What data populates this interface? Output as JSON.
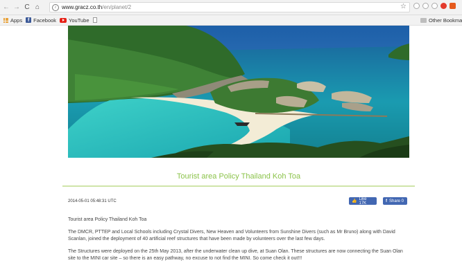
{
  "browser": {
    "url_host": "www.gracz.co.th",
    "url_path": "/en/planet/2",
    "nav": {
      "back": "←",
      "forward": "→",
      "reload": "C",
      "home": "⌂"
    },
    "star": "☆",
    "bookmarks": [
      {
        "label": "Apps",
        "icon": "apps-icon"
      },
      {
        "label": "Facebook",
        "icon": "facebook-icon"
      },
      {
        "label": "YouTube",
        "icon": "youtube-icon"
      },
      {
        "label": "",
        "icon": "document-icon"
      }
    ],
    "other_bookmarks": "Other Bookmarks"
  },
  "article": {
    "title": "Tourist area Policy Thailand Koh Toa",
    "date": "2014-05-01 05:48:31 UTC",
    "like_label": "Like 17K",
    "share_label": "Share 0",
    "paragraphs": [
      "Tourist area Policy Thailand Koh Toa",
      "The DMCR, PTTEP and Local Schools including Crystal Divers, New Heaven and Volunteers from Sunshine Divers (such as Mr Bruno) along with David Scanlan, joined the deployment of 40 artificial reef structures that have been made by volunteers over the last few days.",
      "The Structures were deployed on the 25th May 2013, after the underwater clean up dive, at Suan Olan. These structures are now connecting the Suan Olan site to the MINI car site – so there is an easy pathway, no excuse to not find the MINI. So come check it out!!!"
    ]
  },
  "colors": {
    "title_green": "#8bc34a",
    "facebook_blue": "#4267b2"
  }
}
